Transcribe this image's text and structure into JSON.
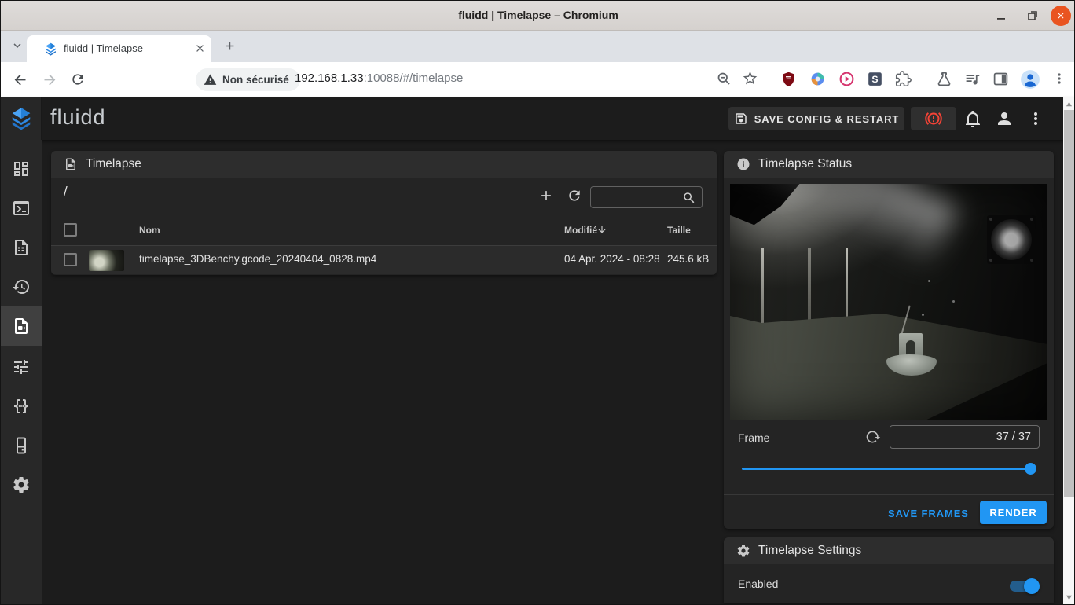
{
  "window": {
    "title": "fluidd | Timelapse – Chromium",
    "controls": {
      "minimize": "–",
      "close": "✕"
    }
  },
  "browser": {
    "tab_title": "fluidd | Timelapse",
    "address": {
      "security_chip": "Non sécurisé",
      "url_host": "192.168.1.33",
      "url_rest": ":10088/#/timelapse"
    }
  },
  "app": {
    "brand": "fluidd",
    "topbar": {
      "save_config_label": "SAVE CONFIG & RESTART"
    },
    "sidebar_items": [
      "dashboard",
      "console",
      "gcode-files",
      "history",
      "timelapse",
      "tune",
      "configuration",
      "system",
      "settings"
    ],
    "file_panel": {
      "title": "Timelapse",
      "path": "/",
      "search_placeholder": "",
      "table": {
        "headers": [
          "Nom",
          "Modifié",
          "Taille"
        ],
        "sort": {
          "column": "Modifié",
          "direction": "desc"
        },
        "rows": [
          {
            "name": "timelapse_3DBenchy.gcode_20240404_0828.mp4",
            "modified": "04 Apr. 2024 - 08:28",
            "size": "245.6 kB"
          }
        ]
      }
    },
    "status_panel": {
      "title": "Timelapse Status",
      "frame_label": "Frame",
      "frame_value": "37 / 37",
      "slider_percent": 100,
      "save_frames_label": "SAVE FRAMES",
      "render_label": "RENDER"
    },
    "settings_panel": {
      "title": "Timelapse Settings",
      "enabled_label": "Enabled",
      "enabled": true
    }
  },
  "icons": {
    "security-warning": "triangle-alert",
    "sort-desc": "arrow-down",
    "emergency-stop": "brake-alert",
    "save": "floppy-disk",
    "notifications": "bell",
    "account": "person",
    "overflow": "kebab-dots"
  },
  "colors": {
    "accent": "#2196f3",
    "danger": "#f44336",
    "close_button": "#e95420",
    "panel": "#242424",
    "panel_header": "#2d2d2d"
  }
}
